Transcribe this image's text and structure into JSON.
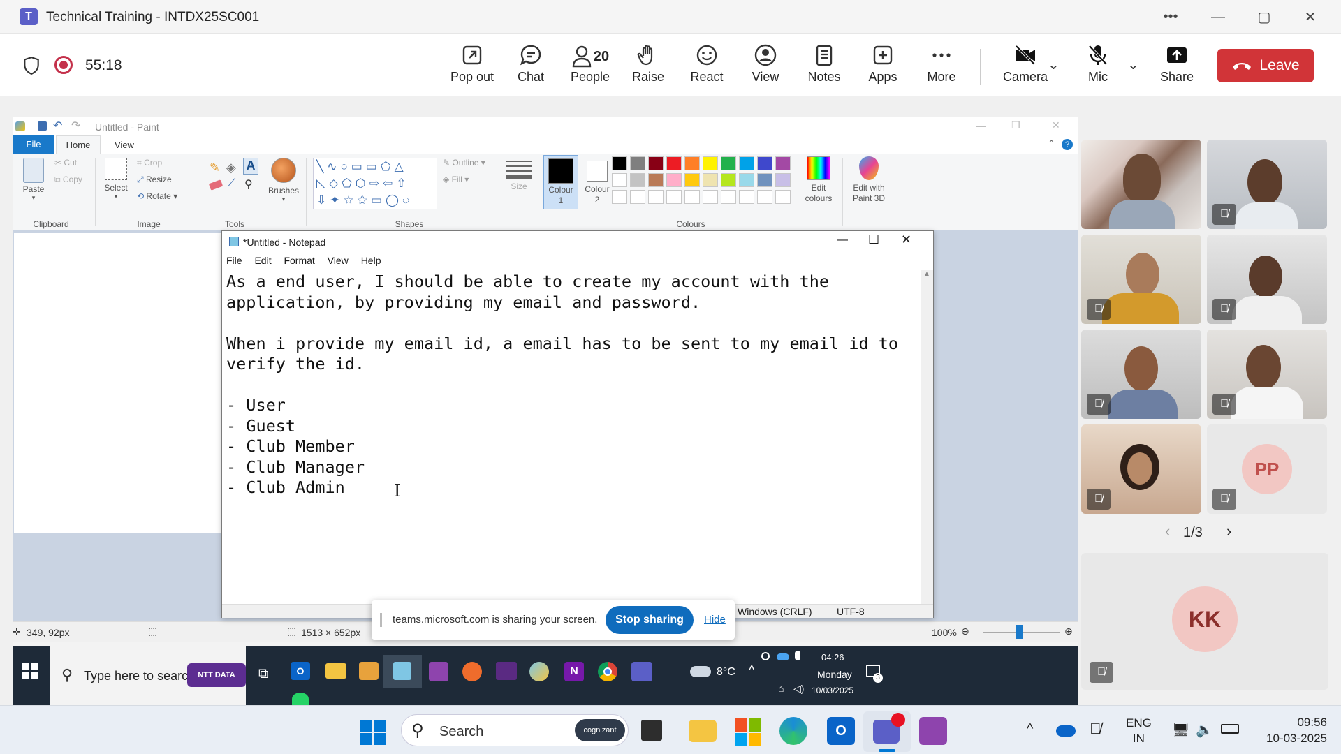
{
  "teams": {
    "window_title": "Technical Training - INTDX25SC001",
    "timer": "55:18",
    "toolbar": {
      "pop_out": "Pop out",
      "chat": "Chat",
      "people": "People",
      "people_count": "20",
      "raise": "Raise",
      "react": "React",
      "view": "View",
      "notes": "Notes",
      "apps": "Apps",
      "more": "More",
      "camera": "Camera",
      "mic": "Mic",
      "share": "Share",
      "leave": "Leave"
    },
    "participants_page": "1/3",
    "avatars": [
      "PP",
      "KK"
    ]
  },
  "paint": {
    "title": "Untitled - Paint",
    "tabs": [
      "File",
      "Home",
      "View"
    ],
    "clipboard": {
      "paste": "Paste",
      "cut": "Cut",
      "copy": "Copy",
      "label": "Clipboard"
    },
    "image": {
      "select": "Select",
      "crop": "Crop",
      "resize": "Resize",
      "rotate": "Rotate",
      "label": "Image"
    },
    "tools_label": "Tools",
    "brushes": "Brushes",
    "shapes": {
      "outline": "Outline",
      "fill": "Fill",
      "label": "Shapes"
    },
    "size": "Size",
    "colour1": "Colour\n1",
    "colour2": "Colour\n2",
    "edit_colours": "Edit\ncolours",
    "edit_paint3d": "Edit with\nPaint 3D",
    "colours_label": "Colours",
    "palette_row1": [
      "#000000",
      "#7f7f7f",
      "#880015",
      "#ed1c24",
      "#ff7f27",
      "#fff200",
      "#22b14c",
      "#00a2e8",
      "#3f48cc",
      "#a349a4"
    ],
    "palette_row2": [
      "#ffffff",
      "#c3c3c3",
      "#b97a57",
      "#ffaec9",
      "#ffc90e",
      "#efe4b0",
      "#b5e61d",
      "#99d9ea",
      "#7092be",
      "#c8bfe7"
    ],
    "status_pos": "349, 92px",
    "status_size": "1513 × 652px",
    "zoom": "100%"
  },
  "notepad": {
    "title": "*Untitled - Notepad",
    "menu": [
      "File",
      "Edit",
      "Format",
      "View",
      "Help"
    ],
    "content": "As a end user, I should be able to create my account with the\napplication, by providing my email and password.\n\nWhen i provide my email id, a email has to be sent to my email id to\nverify the id.\n\n- User\n- Guest\n- Club Member\n- Club Manager\n- Club Admin",
    "status_eol": "Windows (CRLF)",
    "status_enc": "UTF-8"
  },
  "sharebar": {
    "message": "teams.microsoft.com is sharing your screen.",
    "stop": "Stop sharing",
    "hide": "Hide"
  },
  "remote_taskbar": {
    "search": "Type here to search",
    "ntt": "NTT DATA",
    "weather": "8°C",
    "time": "04:26",
    "day": "Monday",
    "date": "10/03/2025",
    "notif_count": "3"
  },
  "taskbar": {
    "search": "Search",
    "search_brand": "cognizant",
    "lang1": "ENG",
    "lang2": "IN",
    "time": "09:56",
    "date": "10-03-2025"
  }
}
